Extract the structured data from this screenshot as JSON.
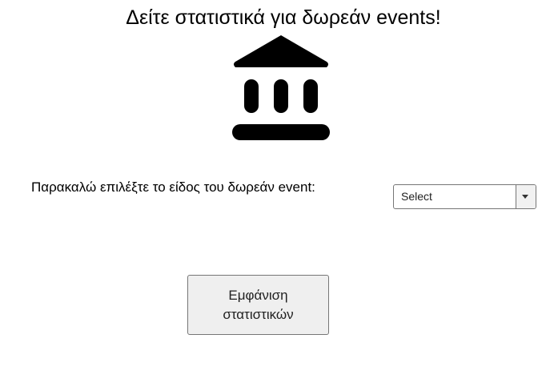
{
  "header": {
    "title": "Δείτε στατιστικά για δωρεάν events!",
    "icon": "bank-building-icon"
  },
  "form": {
    "prompt_label": "Παρακαλώ επιλέξτε το είδος του δωρεάν event:",
    "event_type_select": {
      "selected_value": "Select",
      "icon": "chevron-down-icon"
    },
    "submit_button": {
      "label_line1": "Εμφάνιση",
      "label_line2": "στατιστικών"
    }
  },
  "colors": {
    "background": "#ffffff",
    "text": "#000000",
    "button_bg": "#efefef",
    "control_border": "#767676"
  }
}
